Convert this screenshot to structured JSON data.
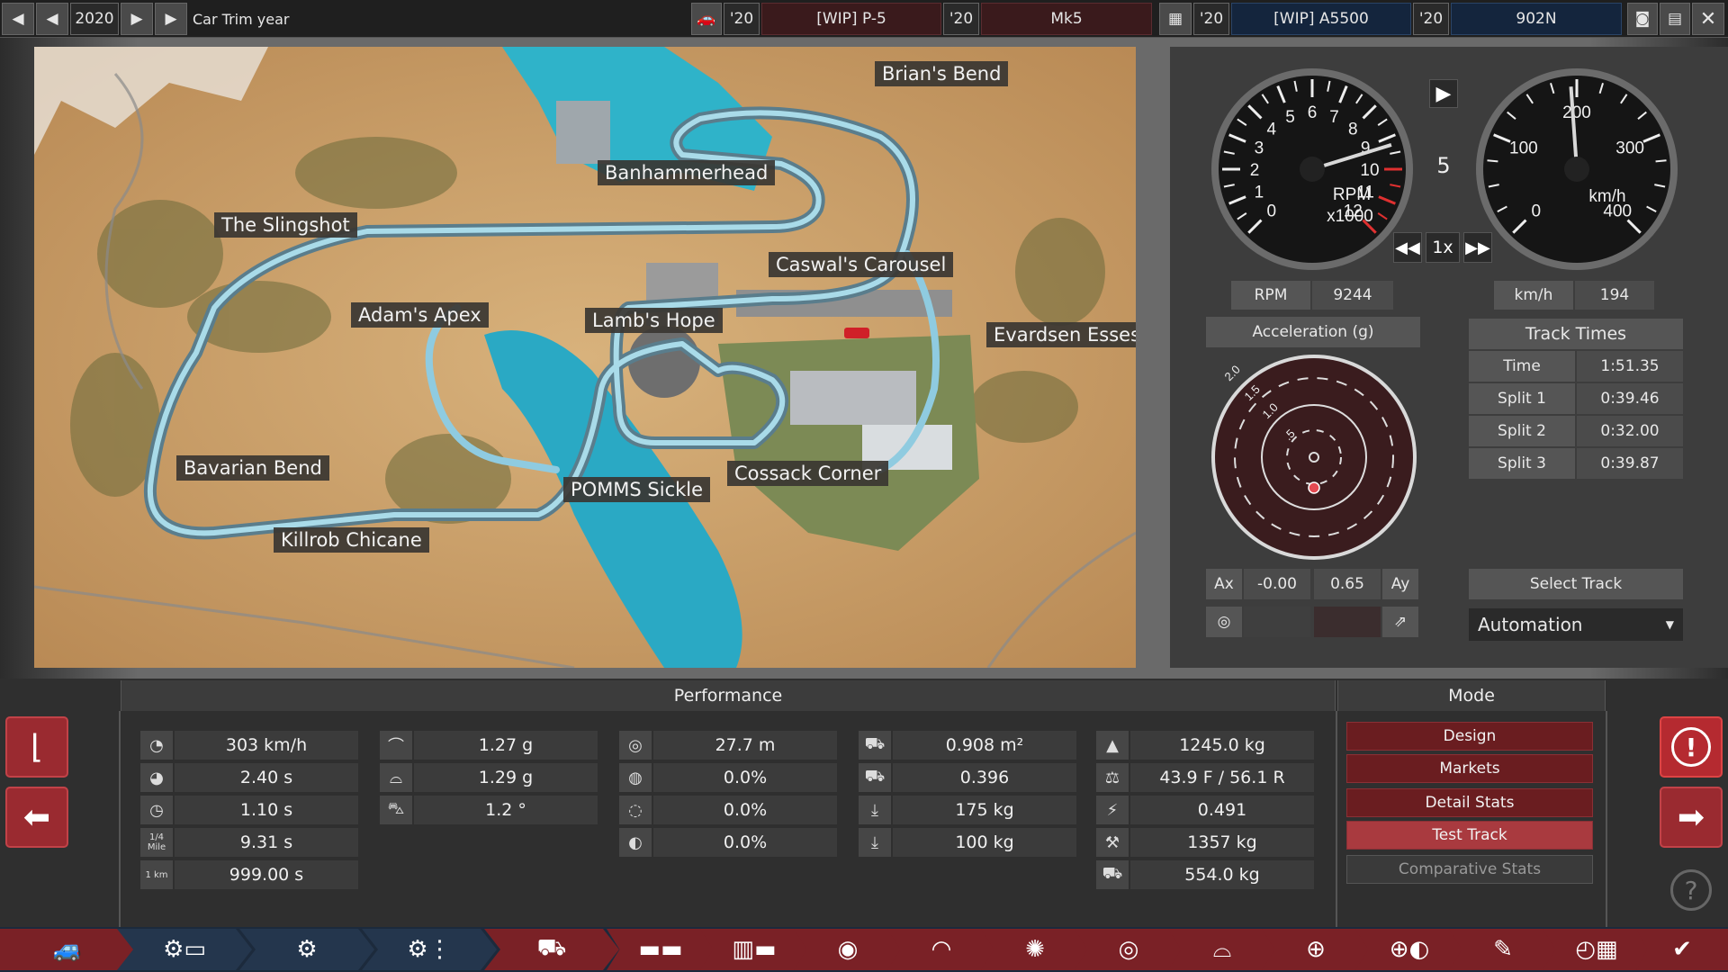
{
  "topbar": {
    "year": "2020",
    "trim_label": "Car Trim year",
    "car1_year": "'20",
    "car1_model": "[WIP] P-5",
    "car1_trim_year": "'20",
    "car1_trim": "Mk5",
    "car2_year": "'20",
    "car2_model": "[WIP] A5500",
    "car2_trim_year": "'20",
    "car2_trim": "902N"
  },
  "track_labels": [
    "Brian's Bend",
    "Banhammerhead",
    "The Slingshot",
    "Caswal's Carousel",
    "Adam's Apex",
    "Lamb's Hope",
    "Evardsen Esses",
    "Bavarian Bend",
    "POMMS Sickle",
    "Cossack Corner",
    "Killrob Chicane"
  ],
  "gauges": {
    "rpm_ticks": [
      "0",
      "1",
      "2",
      "3",
      "4",
      "5",
      "6",
      "7",
      "8",
      "9",
      "10",
      "11",
      "12"
    ],
    "rpm_unit": "RPM",
    "rpm_scale": "x1000",
    "gear": "5",
    "speed_ticks": [
      "0",
      "100",
      "200",
      "300",
      "400"
    ],
    "speed_unit": "km/h",
    "rpm_needle_fraction": 0.77,
    "speed_needle_fraction": 0.485,
    "speed_multiplier": "1x"
  },
  "readouts": {
    "rpm_label": "RPM",
    "rpm_value": "9244",
    "speed_label": "km/h",
    "speed_value": "194"
  },
  "accel": {
    "title": "Acceleration (g)",
    "rings": [
      "2.0",
      "1.5",
      "1.0",
      ".5"
    ],
    "ax_label": "Ax",
    "ax_value": "-0.00",
    "ay_value": "0.65",
    "ay_label": "Ay"
  },
  "track_times": {
    "title": "Track Times",
    "rows": [
      {
        "label": "Time",
        "value": "1:51.35"
      },
      {
        "label": "Split 1",
        "value": "0:39.46"
      },
      {
        "label": "Split 2",
        "value": "0:32.00"
      },
      {
        "label": "Split 3",
        "value": "0:39.87"
      }
    ],
    "select_track": "Select Track",
    "track_name": "Automation"
  },
  "performance": {
    "title": "Performance",
    "col1": [
      {
        "icon": "top-speed-icon",
        "value": "303 km/h"
      },
      {
        "icon": "acceleration-icon",
        "value": "2.40 s"
      },
      {
        "icon": "stopwatch-icon",
        "value": "1.10 s"
      },
      {
        "icon": "quarter-mile-icon",
        "value": "9.31 s",
        "text": "1/4 Mile"
      },
      {
        "icon": "one-km-icon",
        "value": "999.00 s",
        "text": "1 km"
      }
    ],
    "col2": [
      {
        "icon": "cornering-icon",
        "value": "1.27 g"
      },
      {
        "icon": "cornering-high-icon",
        "value": "1.29 g"
      },
      {
        "icon": "body-roll-icon",
        "value": "1.2 °"
      }
    ],
    "col3": [
      {
        "icon": "braking-icon",
        "value": "27.7 m"
      },
      {
        "icon": "brake-fade-icon",
        "value": "0.0%"
      },
      {
        "icon": "brake-heat-icon",
        "value": "0.0%"
      },
      {
        "icon": "brake-wear-icon",
        "value": "0.0%"
      }
    ],
    "col4": [
      {
        "icon": "frontal-area-icon",
        "value": "0.908 m²"
      },
      {
        "icon": "drag-icon",
        "value": "0.396"
      },
      {
        "icon": "front-downforce-icon",
        "value": "175 kg"
      },
      {
        "icon": "rear-downforce-icon",
        "value": "100 kg"
      }
    ],
    "col5": [
      {
        "icon": "weight-icon",
        "value": "1245.0 kg"
      },
      {
        "icon": "weight-distribution-icon",
        "value": "43.9 F / 56.1 R"
      },
      {
        "icon": "power-weight-icon",
        "value": "0.491"
      },
      {
        "icon": "towing-icon",
        "value": "1357 kg"
      },
      {
        "icon": "cargo-icon",
        "value": "554.0 kg"
      }
    ]
  },
  "mode": {
    "title": "Mode",
    "buttons": [
      "Design",
      "Markets",
      "Detail Stats",
      "Test Track",
      "Comparative Stats"
    ]
  },
  "colors": {
    "accent_red": "#a93a3f",
    "tab_blue": "#1c2a3c",
    "tab_red": "#7a2126"
  }
}
